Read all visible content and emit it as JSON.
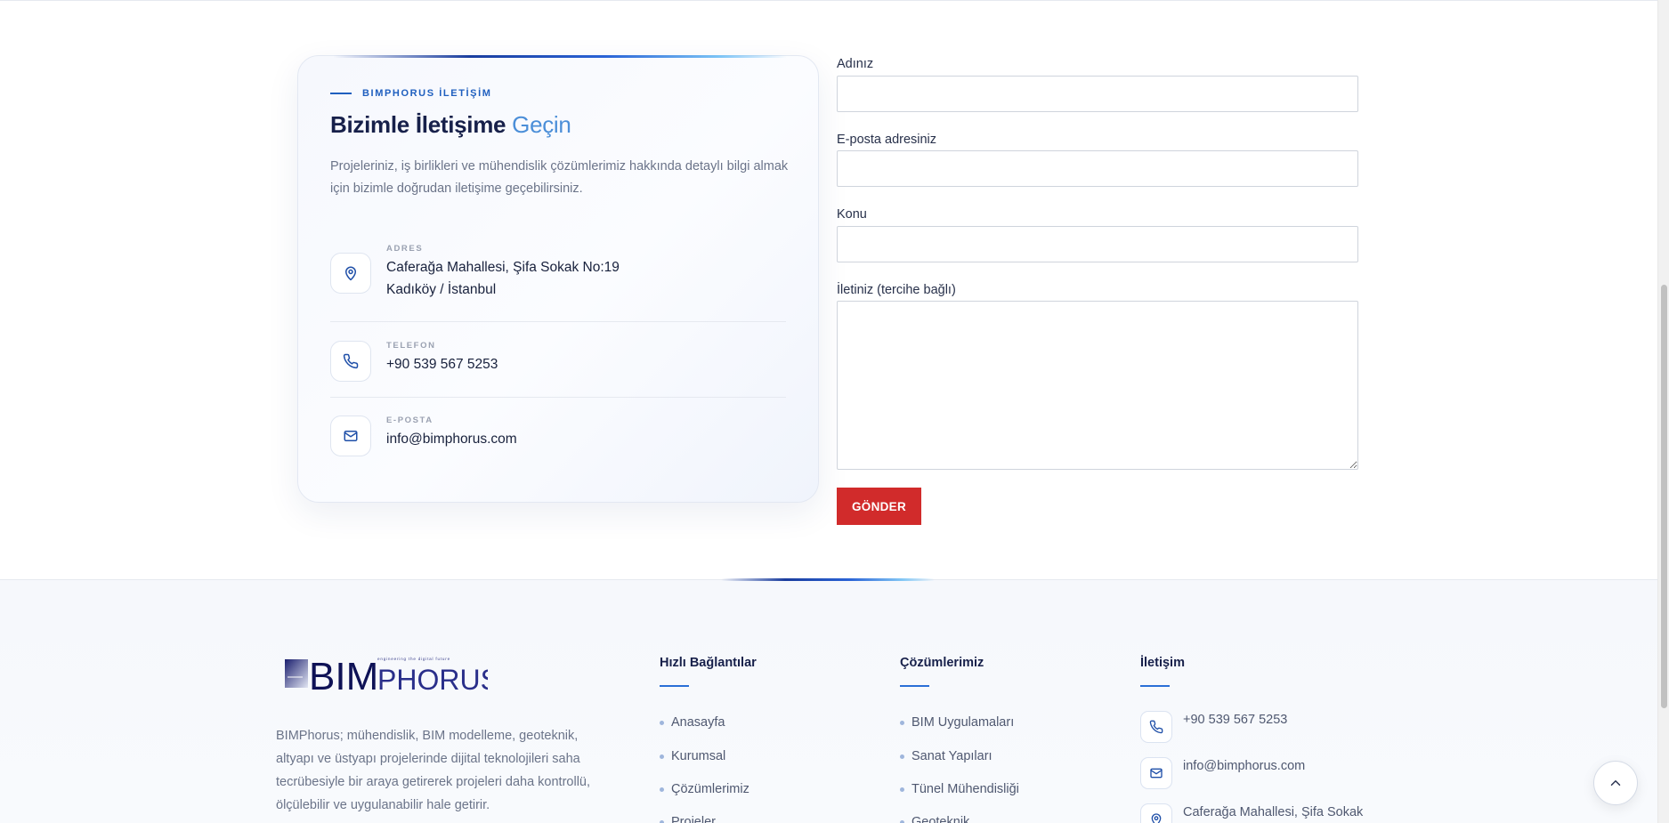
{
  "contact_card": {
    "eyebrow": "BIMPHORUS İLETİŞİM",
    "title_main": "Bizimle İletişime",
    "title_highlight": "Geçin",
    "description": "Projeleriniz, iş birlikleri ve mühendislik çözümlerimiz hakkında detaylı bilgi almak için bizimle doğrudan iletişime geçebilirsiniz.",
    "address": {
      "label": "ADRES",
      "line1": "Caferağa Mahallesi, Şifa Sokak No:19",
      "line2": "Kadıköy / İstanbul",
      "icon": "map-pin-icon"
    },
    "phone": {
      "label": "TELEFON",
      "value": "+90 539 567 5253",
      "icon": "phone-icon"
    },
    "email": {
      "label": "E-POSTA",
      "value": "info@bimphorus.com",
      "icon": "mail-icon"
    }
  },
  "form": {
    "name_label": "Adınız",
    "name_value": "",
    "email_label": "E-posta adresiniz",
    "email_value": "",
    "subject_label": "Konu",
    "subject_value": "",
    "message_label": "İletiniz (tercihe bağlı)",
    "message_value": "",
    "submit_label": "GÖNDER"
  },
  "footer": {
    "logo_text_main": "BIM",
    "logo_text_secondary": "PHORUS",
    "logo_tagline": "engineering the digital future",
    "about": "BIMPhorus; mühendislik, BIM modelleme, geoteknik, altyapı ve üstyapı projelerinde dijital teknolojileri saha tecrübesiyle bir araya getirerek projeleri daha kontrollü, ölçülebilir ve uygulanabilir hale getirir.",
    "quick_links": {
      "title": "Hızlı Bağlantılar",
      "items": [
        "Anasayfa",
        "Kurumsal",
        "Çözümlerimiz",
        "Projeler"
      ]
    },
    "solutions": {
      "title": "Çözümlerimiz",
      "items": [
        "BIM Uygulamaları",
        "Sanat Yapıları",
        "Tünel Mühendisliği",
        "Geoteknik"
      ]
    },
    "contact": {
      "title": "İletişim",
      "phone": "+90 539 567 5253",
      "email": "info@bimphorus.com",
      "address": "Caferağa Mahallesi, Şifa Sokak"
    }
  },
  "colors": {
    "brand_blue": "#1f5fbf",
    "highlight_blue": "#4b8ed8",
    "submit_red": "#d12b2b",
    "heading_navy": "#17204a"
  },
  "icons": {
    "scroll_top": "chevron-up-icon"
  }
}
